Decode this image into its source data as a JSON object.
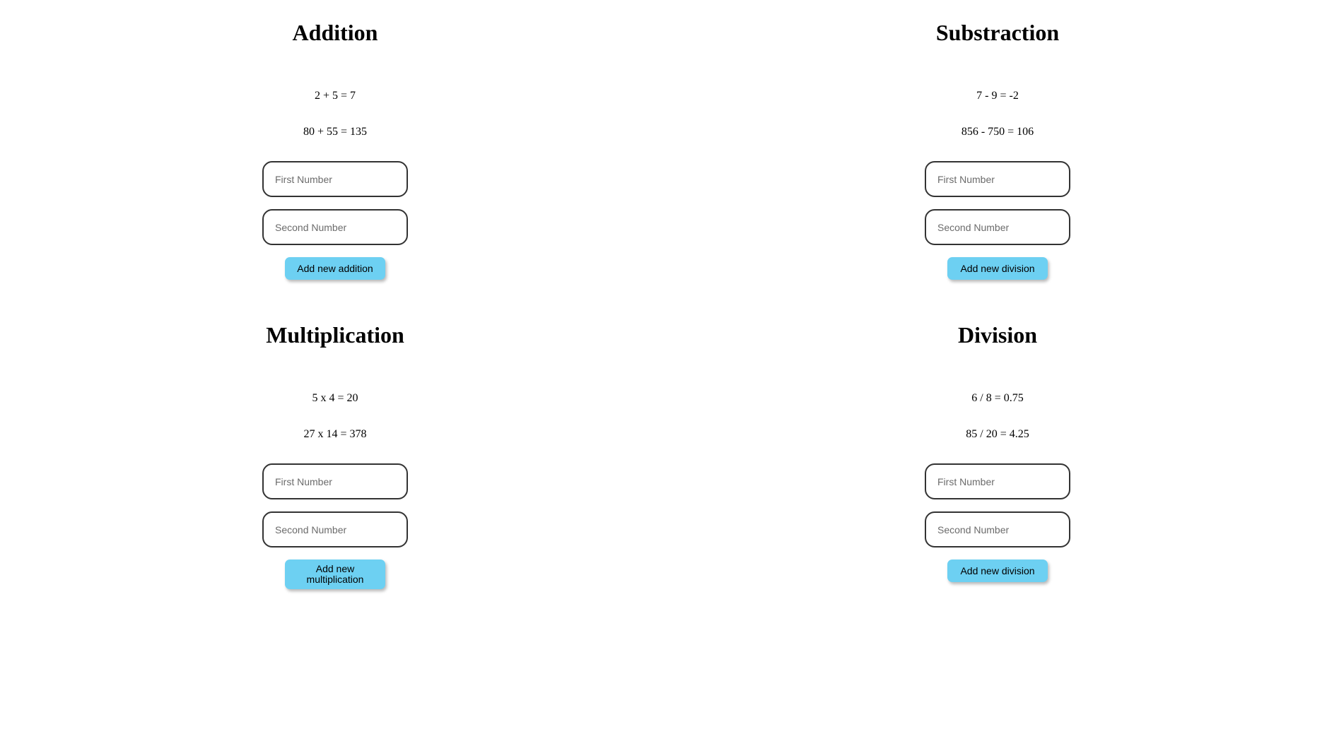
{
  "addition": {
    "title": "Addition",
    "results": [
      "2 + 5 = 7",
      "80 + 55 = 135"
    ],
    "first_placeholder": "First Number",
    "second_placeholder": "Second Number",
    "button_label": "Add new addition"
  },
  "subtraction": {
    "title": "Substraction",
    "results": [
      "7 - 9 = -2",
      "856 - 750 = 106"
    ],
    "first_placeholder": "First Number",
    "second_placeholder": "Second Number",
    "button_label": "Add new division"
  },
  "multiplication": {
    "title": "Multiplication",
    "results": [
      "5 x 4 = 20",
      "27 x 14 = 378"
    ],
    "first_placeholder": "First Number",
    "second_placeholder": "Second Number",
    "button_label": "Add new multiplication"
  },
  "division": {
    "title": "Division",
    "results": [
      "6 / 8 = 0.75",
      "85 / 20 = 4.25"
    ],
    "first_placeholder": "First Number",
    "second_placeholder": "Second Number",
    "button_label": "Add new division"
  }
}
